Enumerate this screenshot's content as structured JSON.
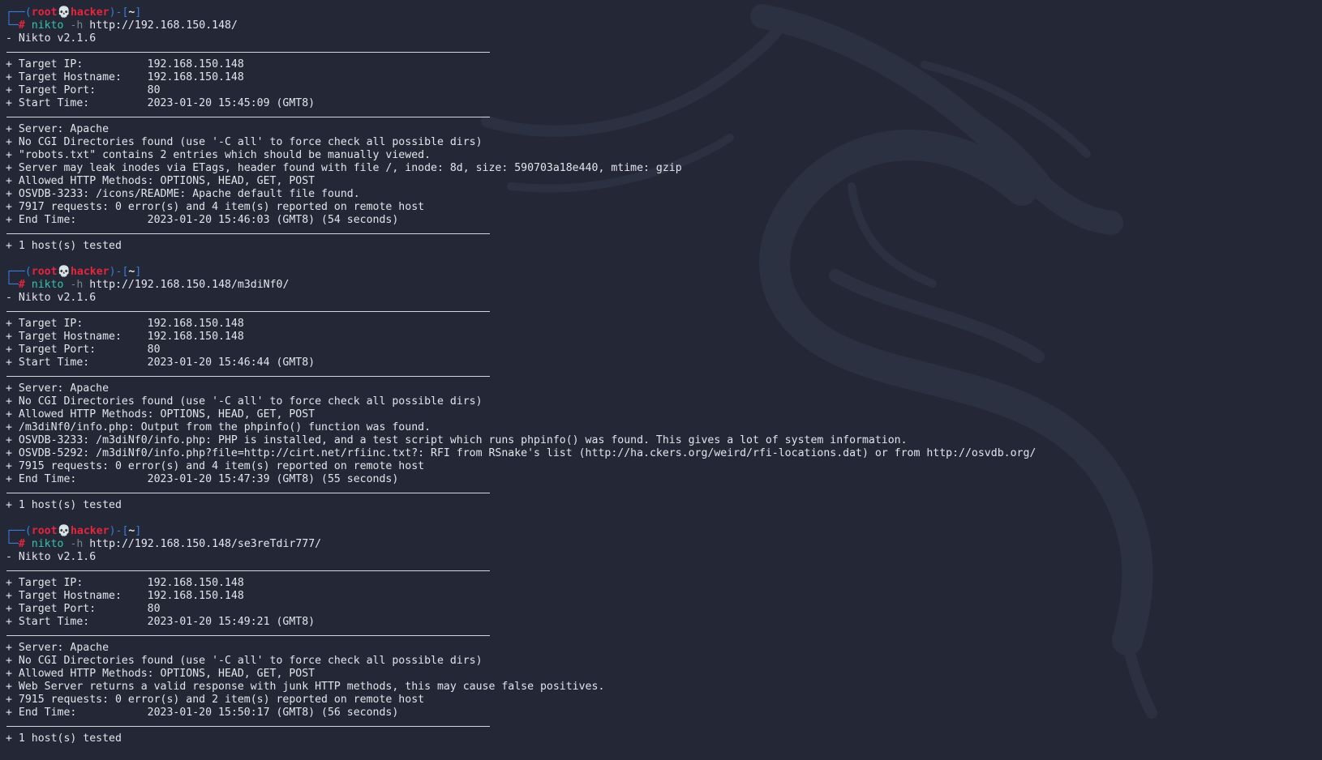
{
  "prompt": {
    "user": "root",
    "skull": "💀",
    "host": "hacker",
    "dir": "~",
    "hash": "#"
  },
  "sessions": [
    {
      "command": "nikto",
      "flag": "-h",
      "url": "http://192.168.150.148/",
      "version": "- Nikto v2.1.6",
      "info": [
        "+ Target IP:          192.168.150.148",
        "+ Target Hostname:    192.168.150.148",
        "+ Target Port:        80",
        "+ Start Time:         2023-01-20 15:45:09 (GMT8)"
      ],
      "findings": [
        "+ Server: Apache",
        "+ No CGI Directories found (use '-C all' to force check all possible dirs)",
        "+ \"robots.txt\" contains 2 entries which should be manually viewed.",
        "+ Server may leak inodes via ETags, header found with file /, inode: 8d, size: 590703a18e440, mtime: gzip",
        "+ Allowed HTTP Methods: OPTIONS, HEAD, GET, POST",
        "+ OSVDB-3233: /icons/README: Apache default file found.",
        "+ 7917 requests: 0 error(s) and 4 item(s) reported on remote host",
        "+ End Time:           2023-01-20 15:46:03 (GMT8) (54 seconds)"
      ],
      "summary": "+ 1 host(s) tested"
    },
    {
      "command": "nikto",
      "flag": "-h",
      "url": "http://192.168.150.148/m3diNf0/",
      "version": "- Nikto v2.1.6",
      "info": [
        "+ Target IP:          192.168.150.148",
        "+ Target Hostname:    192.168.150.148",
        "+ Target Port:        80",
        "+ Start Time:         2023-01-20 15:46:44 (GMT8)"
      ],
      "findings": [
        "+ Server: Apache",
        "+ No CGI Directories found (use '-C all' to force check all possible dirs)",
        "+ Allowed HTTP Methods: OPTIONS, HEAD, GET, POST",
        "+ /m3diNf0/info.php: Output from the phpinfo() function was found.",
        "+ OSVDB-3233: /m3diNf0/info.php: PHP is installed, and a test script which runs phpinfo() was found. This gives a lot of system information.",
        "+ OSVDB-5292: /m3diNf0/info.php?file=http://cirt.net/rfiinc.txt?: RFI from RSnake's list (http://ha.ckers.org/weird/rfi-locations.dat) or from http://osvdb.org/",
        "+ 7915 requests: 0 error(s) and 4 item(s) reported on remote host",
        "+ End Time:           2023-01-20 15:47:39 (GMT8) (55 seconds)"
      ],
      "summary": "+ 1 host(s) tested"
    },
    {
      "command": "nikto",
      "flag": "-h",
      "url": "http://192.168.150.148/se3reTdir777/",
      "version": "- Nikto v2.1.6",
      "info": [
        "+ Target IP:          192.168.150.148",
        "+ Target Hostname:    192.168.150.148",
        "+ Target Port:        80",
        "+ Start Time:         2023-01-20 15:49:21 (GMT8)"
      ],
      "findings": [
        "+ Server: Apache",
        "+ No CGI Directories found (use '-C all' to force check all possible dirs)",
        "+ Allowed HTTP Methods: OPTIONS, HEAD, GET, POST",
        "+ Web Server returns a valid response with junk HTTP methods, this may cause false positives.",
        "+ 7915 requests: 0 error(s) and 2 item(s) reported on remote host",
        "+ End Time:           2023-01-20 15:50:17 (GMT8) (56 seconds)"
      ],
      "summary": "+ 1 host(s) tested"
    }
  ]
}
